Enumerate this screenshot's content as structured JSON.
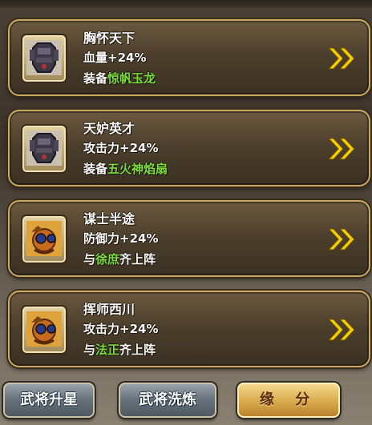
{
  "fate_cards": [
    {
      "title": "胸怀天下",
      "stat": "血量+24%",
      "req_prefix": "装备",
      "req_highlight": "惊帆玉龙",
      "req_suffix": "",
      "icon": "armor-icon"
    },
    {
      "title": "天妒英才",
      "stat": "攻击力+24%",
      "req_prefix": "装备",
      "req_highlight": "五火神焰扇",
      "req_suffix": "",
      "icon": "armor-icon"
    },
    {
      "title": "谋士半途",
      "stat": "防御力+24%",
      "req_prefix": "与",
      "req_highlight": "徐庶",
      "req_suffix": "齐上阵",
      "icon": "general-portrait-icon"
    },
    {
      "title": "挥师西川",
      "stat": "攻击力+24%",
      "req_prefix": "与",
      "req_highlight": "法正",
      "req_suffix": "齐上阵",
      "icon": "general-portrait-icon"
    }
  ],
  "bottom_tabs": {
    "upgrade_star": "武将升星",
    "refine": "武将洗炼",
    "fate": "缘 分"
  },
  "colors": {
    "highlight": "#7cdc3c",
    "card_border": "#c9a866",
    "arrow": "#f4d000"
  }
}
